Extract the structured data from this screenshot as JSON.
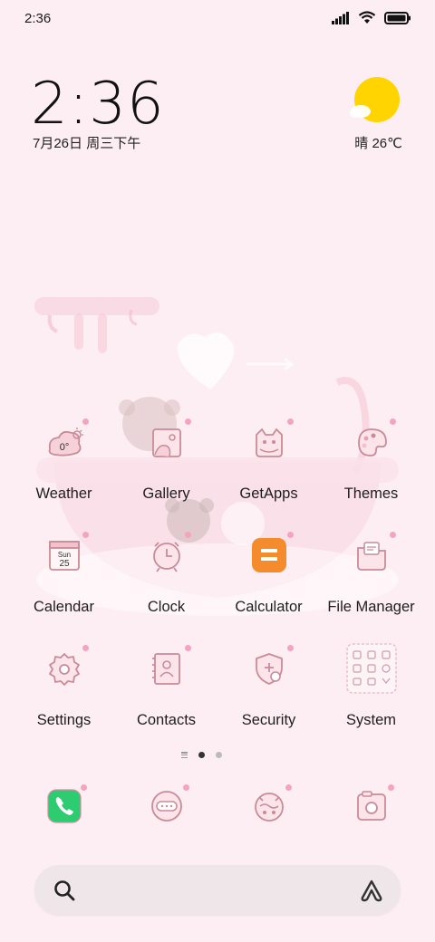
{
  "status_bar": {
    "time": "2:36"
  },
  "clock_widget": {
    "time": "2:36",
    "date": "7月26日 周三下午"
  },
  "weather_widget": {
    "text": "晴 26℃"
  },
  "apps": [
    [
      {
        "label": "Weather",
        "badge": "0°"
      },
      {
        "label": "Gallery"
      },
      {
        "label": "GetApps"
      },
      {
        "label": "Themes"
      }
    ],
    [
      {
        "label": "Calendar",
        "day": "Sun",
        "date": "25"
      },
      {
        "label": "Clock"
      },
      {
        "label": "Calculator"
      },
      {
        "label": "File Manager"
      }
    ],
    [
      {
        "label": "Settings"
      },
      {
        "label": "Contacts"
      },
      {
        "label": "Security"
      },
      {
        "label": "System"
      }
    ]
  ],
  "pager": {
    "pages": 2,
    "current": 1
  },
  "dock": [
    "phone-icon",
    "messages-icon",
    "browser-icon",
    "camera-icon"
  ],
  "colors": {
    "background": "#fdeef3",
    "icon_stroke": "#c98b97",
    "accent_pink": "#f4a5bd",
    "calculator_orange": "#f48b2c",
    "phone_green": "#2ecc71",
    "sun_yellow": "#ffd400"
  }
}
